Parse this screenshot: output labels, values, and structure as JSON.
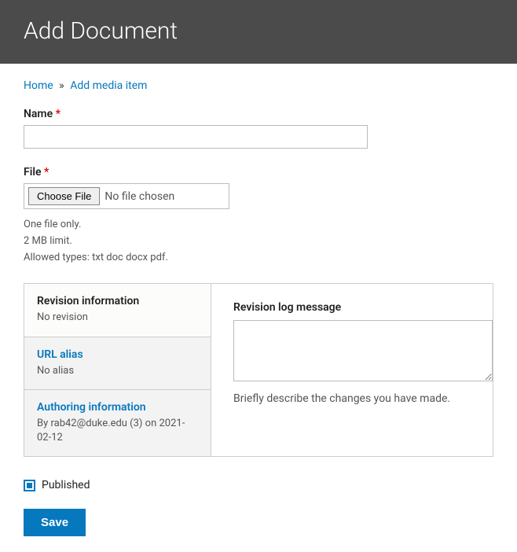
{
  "header": {
    "title": "Add Document"
  },
  "breadcrumb": {
    "home": "Home",
    "sep": "»",
    "add_media": "Add media item"
  },
  "form": {
    "name": {
      "label": "Name",
      "value": ""
    },
    "file": {
      "label": "File",
      "button": "Choose File",
      "status": "No file chosen",
      "help_lines": [
        "One file only.",
        "2 MB limit.",
        "Allowed types: txt doc docx pdf."
      ]
    }
  },
  "vtabs": [
    {
      "title": "Revision information",
      "sub": "No revision",
      "active": true,
      "link": false
    },
    {
      "title": "URL alias",
      "sub": "No alias",
      "active": false,
      "link": true
    },
    {
      "title": "Authoring information",
      "sub": "By rab42@duke.edu (3) on 2021-02-12",
      "active": false,
      "link": true
    }
  ],
  "revision": {
    "label": "Revision log message",
    "value": "",
    "help": "Briefly describe the changes you have made."
  },
  "published": {
    "label": "Published",
    "checked": true
  },
  "actions": {
    "save": "Save"
  }
}
